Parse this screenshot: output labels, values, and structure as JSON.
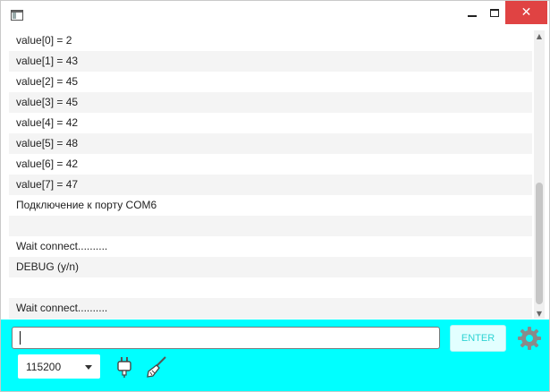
{
  "window": {
    "title": "",
    "icons": {
      "app": "app-window-icon",
      "minimize": "minimize-icon",
      "maximize": "maximize-icon",
      "close": "close-icon"
    },
    "close_color": "#e04343"
  },
  "console": {
    "lines": [
      "value[0] = 2",
      "value[1] = 43",
      "value[2] = 45",
      "value[3] = 45",
      "value[4] = 42",
      "value[5] = 48",
      "value[6] = 42",
      "value[7] = 47",
      "Подключение к порту COM6",
      "",
      "Wait connect..........",
      "DEBUG (y/n)",
      "",
      "Wait connect.........."
    ]
  },
  "controls": {
    "background": "#00ffff",
    "command_input": {
      "value": "",
      "placeholder": ""
    },
    "enter_label": "ENTER",
    "settings_icon": "gear-icon",
    "baud_rate": {
      "selected": "115200"
    },
    "connect_icon": "usb-plug-icon",
    "clear_icon": "broom-icon"
  }
}
